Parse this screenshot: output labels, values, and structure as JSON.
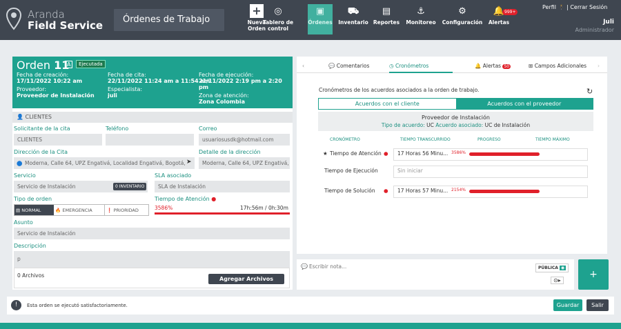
{
  "brand": {
    "line1": "Aranda",
    "line2": "Field Service"
  },
  "module_title": "Órdenes de Trabajo",
  "nav": [
    {
      "label": "Nueva Orden",
      "icon": "plus-icon"
    },
    {
      "label": "Tablero de control",
      "icon": "dashboard-icon"
    },
    {
      "label": "Órdenes",
      "icon": "orders-icon"
    },
    {
      "label": "Inventario",
      "icon": "cart-icon"
    },
    {
      "label": "Reportes",
      "icon": "report-icon"
    },
    {
      "label": "Monitoreo",
      "icon": "monitor-icon"
    },
    {
      "label": "Configuración",
      "icon": "gear-icon"
    },
    {
      "label": "Alertas",
      "icon": "bell-icon",
      "badge": "999+"
    }
  ],
  "account": {
    "perfil": "Perfil",
    "separator": "|",
    "logout": "Cerrar Sesión",
    "user": "Juli",
    "role": "Administrador"
  },
  "order": {
    "title": "Orden",
    "number": "11",
    "tag": "A",
    "status": "Ejecutada",
    "created_lbl": "Fecha de creación:",
    "created": "17/11/2022 10:22 am",
    "appt_lbl": "Fecha de cita:",
    "appt": "22/11/2022 11:24 am a 11:54 am",
    "exec_lbl": "Fecha de ejecución:",
    "exec": "21/11/2022 2:19 pm a 2:20 pm",
    "provider_lbl": "Proveedor:",
    "provider": "Proveedor de Instalación",
    "specialist_lbl": "Especialista:",
    "specialist": "juli",
    "zone_lbl": "Zona de atención:",
    "zone": "Zona Colombia"
  },
  "client": {
    "section": "CLIENTES",
    "requester_lbl": "Solicitante de la cita",
    "requester": "CLIENTES",
    "phone_lbl": "Teléfono",
    "phone": "",
    "email_lbl": "Correo",
    "email": "usuariosusdk@hotmail.com",
    "address_lbl": "Dirección de la Cita",
    "address": "Moderna, Calle 64, UPZ Engativá, Localidad Engativá, Bogotá,",
    "address_detail_lbl": "Detalle de la dirección",
    "address_detail": "Moderna, Calle 64, UPZ Engativá, L"
  },
  "service": {
    "service_lbl": "Servicio",
    "service": "Servicio de Instalación",
    "inventory_badge": "0 INVENTARIO",
    "sla_lbl": "SLA asociado",
    "sla": "SLA de Instalación",
    "type_lbl": "Tipo de orden",
    "types": [
      "NORMAL",
      "EMERGENCIA",
      "PRIORIDAD"
    ],
    "attention_lbl": "Tiempo de Atención",
    "attention_pct": "3586%",
    "attention_time": "17h:56m / 0h:30m",
    "subject_lbl": "Asunto",
    "subject": "Servicio de Instalación",
    "desc_lbl": "Descripción",
    "desc": "p",
    "files": "0 Archivos",
    "add_files": "Agregar Archivos"
  },
  "tabs": [
    "Comentarios",
    "Cronómetros",
    "Alertas",
    "Campos Adicionales"
  ],
  "alert_badge": "50",
  "chrono": {
    "intro": "Cronómetros de los acuerdos asociados a la orden de trabajo.",
    "seg_client": "Acuerdos con el cliente",
    "seg_provider": "Acuerdos con el proveedor",
    "provider_name": "Proveedor de Instalación",
    "agreement_type_lbl": "Tipo de acuerdo:",
    "agreement_type": "UC",
    "agreement_lbl": "Acuerdo asociado:",
    "agreement": "UC de Instalación",
    "cols": [
      "CRONÓMETRO",
      "TIEMPO TRANSCURRIDO",
      "PROGRESO",
      "TIEMPO MÁXIMO"
    ],
    "rows": [
      {
        "star": "★",
        "name": "Tiempo de Atención",
        "elapsed": "17 Horas 56 Minu...",
        "pct": "3586%"
      },
      {
        "star": "",
        "name": "Tiempo de Ejecución",
        "elapsed": "Sin iniciar",
        "pct": ""
      },
      {
        "star": "",
        "name": "Tiempo de Solución",
        "elapsed": "17 Horas 57 Minu...",
        "pct": "2154%"
      }
    ]
  },
  "note": {
    "placeholder": "Escribir nota...",
    "public": "PÚBLICA"
  },
  "footer": {
    "message": "Esta orden se ejecutó satisfactoriamente.",
    "save": "Guardar",
    "exit": "Salir"
  }
}
